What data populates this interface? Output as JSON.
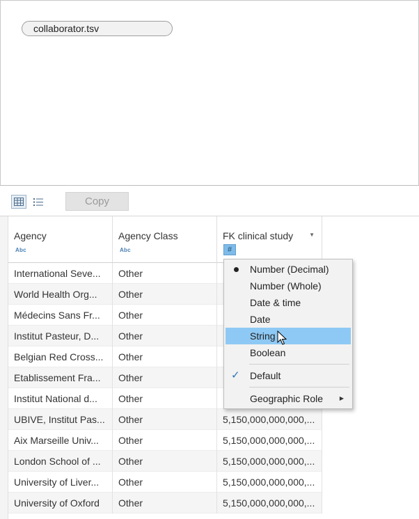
{
  "canvas": {
    "source_name": "collaborator.tsv"
  },
  "toolbar": {
    "copy_label": "Copy"
  },
  "columns": [
    {
      "name": "Agency",
      "type_badge": "Abc"
    },
    {
      "name": "Agency Class",
      "type_badge": "Abc"
    },
    {
      "name": "FK clinical study",
      "type_badge": "#"
    }
  ],
  "rows": [
    [
      "International Seve...",
      "Other",
      ""
    ],
    [
      "World Health Org...",
      "Other",
      ""
    ],
    [
      "Médecins Sans Fr...",
      "Other",
      ""
    ],
    [
      "Institut Pasteur, D...",
      "Other",
      ""
    ],
    [
      "Belgian Red Cross...",
      "Other",
      ""
    ],
    [
      "Etablissement Fra...",
      "Other",
      ""
    ],
    [
      "Institut National d...",
      "Other",
      ""
    ],
    [
      "UBIVE, Institut Pas...",
      "Other",
      "5,150,000,000,000,..."
    ],
    [
      "Aix Marseille Univ...",
      "Other",
      "5,150,000,000,000,..."
    ],
    [
      "London School of ...",
      "Other",
      "5,150,000,000,000,..."
    ],
    [
      "University of Liver...",
      "Other",
      "5,150,000,000,000,..."
    ],
    [
      "University of Oxford",
      "Other",
      "5,150,000,000,000,..."
    ]
  ],
  "type_menu": {
    "items": [
      {
        "label": "Number (Decimal)",
        "selected": true
      },
      {
        "label": "Number (Whole)"
      },
      {
        "label": "Date & time"
      },
      {
        "label": "Date"
      },
      {
        "label": "String",
        "highlighted": true
      },
      {
        "label": "Boolean"
      }
    ],
    "default_label": "Default",
    "geographic_label": "Geographic Role"
  },
  "colors": {
    "accent": "#8ec9f5",
    "number_badge": "#7fbbe8",
    "string_badge_text": "#4a7fb5"
  }
}
